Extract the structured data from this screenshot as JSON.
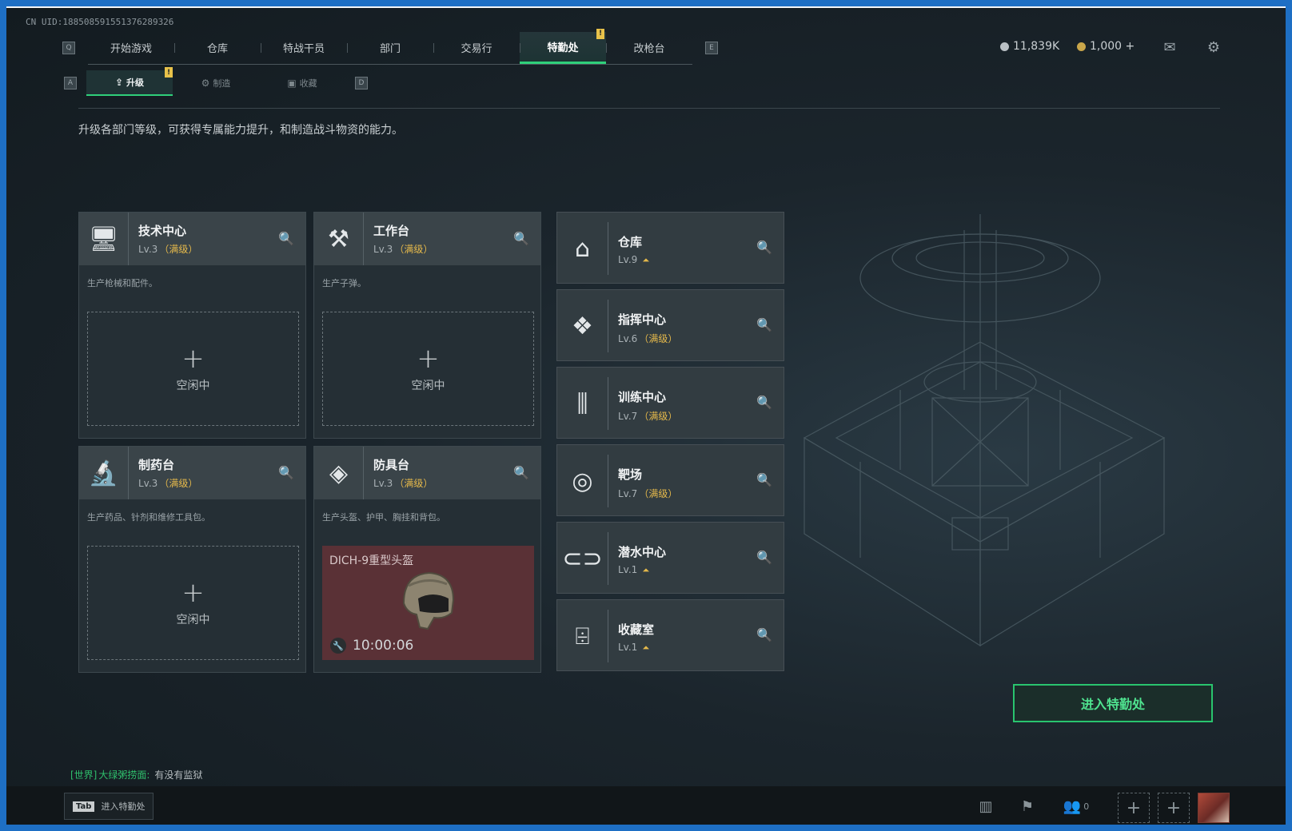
{
  "uid_text": "CN UID:18850859155137628932​6",
  "nav": {
    "left_key": "Q",
    "right_key": "E",
    "tabs": [
      "开始游戏",
      "仓库",
      "特战干员",
      "部门",
      "交易行",
      "特勤处",
      "改枪台"
    ],
    "active": "特勤处",
    "badge": "!"
  },
  "currency": {
    "silver": "11,839K",
    "gold": "1,000 +"
  },
  "subnav": {
    "left_key": "A",
    "right_key": "D",
    "tabs": [
      "升级",
      "制造",
      "收藏"
    ],
    "active": "升级",
    "badge": "!"
  },
  "description": "升级各部门等级，可获得专属能力提升，和制造战斗物资的能力。",
  "workshops": [
    {
      "name": "技术中心",
      "level": "Lv.3",
      "max": "（满级）",
      "desc": "生产枪械和配件。",
      "icon": "computer-icon",
      "slot": {
        "plus": "+",
        "status": "空闲中"
      }
    },
    {
      "name": "工作台",
      "level": "Lv.3",
      "max": "（满级）",
      "desc": "生产子弹。",
      "icon": "hammer-wrench-icon",
      "slot": {
        "plus": "+",
        "status": "空闲中"
      }
    },
    {
      "name": "制药台",
      "level": "Lv.3",
      "max": "（满级）",
      "desc": "生产药品、针剂和维修工具包。",
      "icon": "microscope-icon",
      "slot": {
        "plus": "+",
        "status": "空闲中"
      }
    },
    {
      "name": "防具台",
      "level": "Lv.3",
      "max": "（满级）",
      "desc": "生产头盔、护甲、胸挂和背包。",
      "icon": "armor-blocks-icon",
      "crafting": {
        "item": "DICH-9重型头盔",
        "timer": "10:00:06"
      }
    }
  ],
  "facilities": [
    {
      "name": "仓库",
      "level": "Lv.9",
      "max": "",
      "upgradable": true,
      "icon": "warehouse-icon"
    },
    {
      "name": "指挥中心",
      "level": "Lv.6",
      "max": "（满级）",
      "upgradable": false,
      "icon": "command-icon"
    },
    {
      "name": "训练中心",
      "level": "Lv.7",
      "max": "（满级）",
      "upgradable": false,
      "icon": "dumbbell-icon"
    },
    {
      "name": "靶场",
      "level": "Lv.7",
      "max": "（满级）",
      "upgradable": false,
      "icon": "target-icon"
    },
    {
      "name": "潜水中心",
      "level": "Lv.1",
      "max": "",
      "upgradable": true,
      "icon": "diving-mask-icon"
    },
    {
      "name": "收藏室",
      "level": "Lv.1",
      "max": "",
      "upgradable": true,
      "icon": "collection-icon"
    }
  ],
  "enter_button": "进入特勤处",
  "chat": {
    "channel": "[世界]",
    "sender": "大绿粥捞面:",
    "message": "有没有监狱"
  },
  "bottom": {
    "hint_key": "Tab",
    "hint_text": "进入特勤处",
    "friends_count": "0"
  },
  "colors": {
    "accent_green": "#2fd07a",
    "max_level_gold": "#e5b94b",
    "crafting_bg": "#5a3136"
  }
}
